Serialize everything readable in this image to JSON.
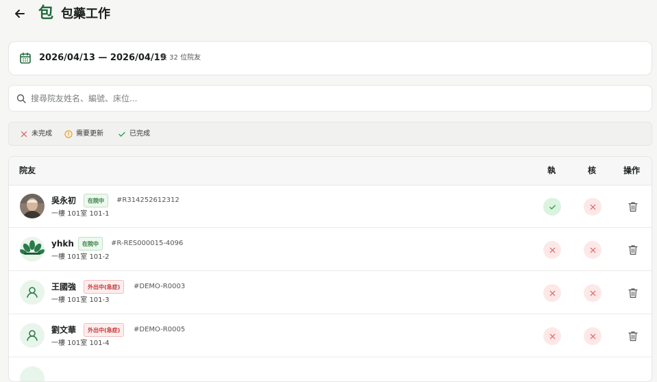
{
  "header": {
    "logo_text": "包",
    "title": "包藥工作"
  },
  "date_bar": {
    "range": "2026/04/13 — 2026/04/19",
    "count": "共 32 位院友"
  },
  "search": {
    "placeholder": "搜尋院友姓名、編號、床位..."
  },
  "legend": {
    "incomplete": "未完成",
    "needs_update": "需要更新",
    "complete": "已完成"
  },
  "table": {
    "headers": {
      "resident": "院友",
      "exec": "執",
      "check": "核",
      "actions": "操作"
    },
    "rows": [
      {
        "name": "吳永初",
        "status": "在院中",
        "id": "#R314252612312",
        "bed": "一樓 101室 101-1",
        "exec": "done",
        "check": "todo"
      },
      {
        "name": "yhkh",
        "status": "在院中",
        "id": "#R-RES000015-4096",
        "bed": "一樓 101室 101-2",
        "exec": "todo",
        "check": "todo"
      },
      {
        "name": "王國強",
        "status": "外出中(急症)",
        "id": "#DEMO-R0003",
        "bed": "一樓 101室 101-3",
        "exec": "todo",
        "check": "todo"
      },
      {
        "name": "劉文華",
        "status": "外出中(急症)",
        "id": "#DEMO-R0005",
        "bed": "一樓 101室 101-4",
        "exec": "todo",
        "check": "todo"
      }
    ]
  },
  "colors": {
    "brand": "#1f6b3b",
    "done": "#2e9d4a",
    "todo": "#e26a6a",
    "warn": "#e8a020"
  }
}
